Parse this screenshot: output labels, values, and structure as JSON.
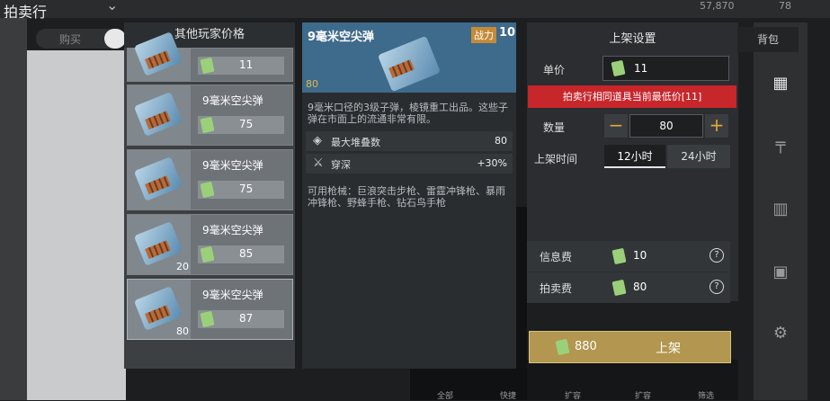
{
  "header": {
    "title": "拍卖行",
    "dropdown_icon": "chevron-down-icon",
    "currency1": "57,870",
    "currency2": "78"
  },
  "tabs": {
    "buy": "购买",
    "bag": "背包"
  },
  "price_list": {
    "title": "其他玩家价格",
    "rows": [
      {
        "name": "",
        "price": "11",
        "qty": ""
      },
      {
        "name": "9毫米空尖弹",
        "price": "75",
        "qty": ""
      },
      {
        "name": "9毫米空尖弹",
        "price": "75",
        "qty": ""
      },
      {
        "name": "9毫米空尖弹",
        "price": "85",
        "qty": "20"
      },
      {
        "name": "9毫米空尖弹",
        "price": "87",
        "qty": "80"
      }
    ]
  },
  "detail": {
    "name": "9毫米空尖弹",
    "power_label": "战力",
    "power_value": "10",
    "qty": "80",
    "description": "9毫米口径的3级子弹，棱镜重工出品。这些子弹在市面上的流通非常有限。",
    "stats": [
      {
        "label": "最大堆叠数",
        "value": "80",
        "icon": "layers-icon"
      },
      {
        "label": "穿深",
        "value": "+30%",
        "icon": "penetration-icon"
      }
    ],
    "guns": "可用枪械：巨浪突击步枪、雷霆冲锋枪、暴雨冲锋枪、野蜂手枪、钻石鸟手枪"
  },
  "listing": {
    "title": "上架设置",
    "price_label": "单价",
    "price_value": "11",
    "alert": "拍卖行相同道具当前最低价[11]",
    "qty_label": "数量",
    "qty_value": "80",
    "minus": "−",
    "plus": "+",
    "time_label": "上架时间",
    "time_options": [
      "12小时",
      "24小时"
    ],
    "info_fee_label": "信息费",
    "info_fee_value": "10",
    "auction_fee_label": "拍卖费",
    "auction_fee_value": "80",
    "help": "?",
    "total": "880",
    "submit": "上架"
  },
  "bottom_labels": [
    "全部",
    "快捷",
    "扩容",
    "扩容",
    "筛选"
  ]
}
